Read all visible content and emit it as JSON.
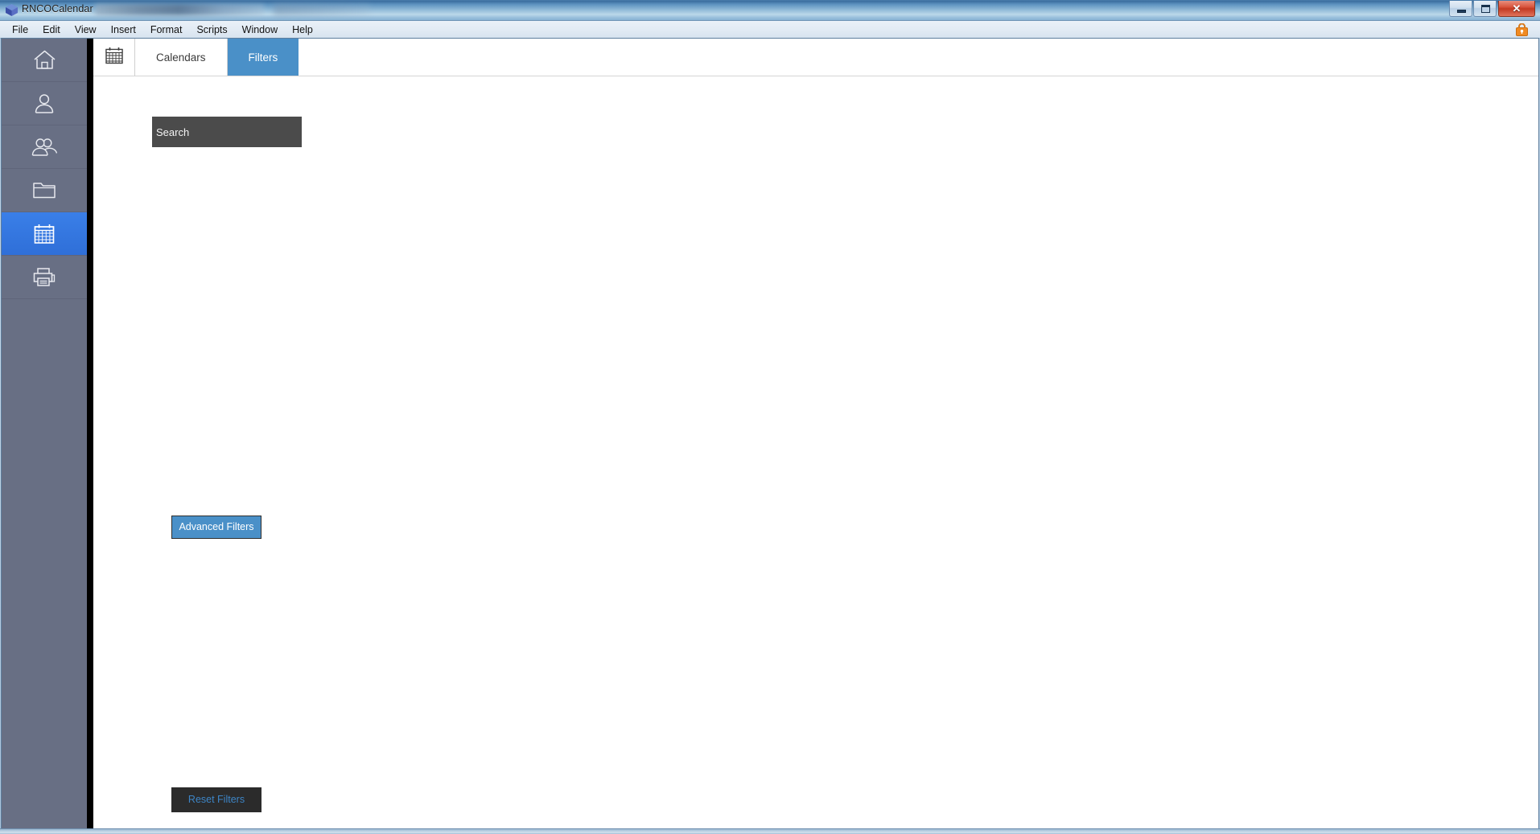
{
  "window": {
    "title": "RNCOCalendar",
    "app_icon": "cube-icon",
    "controls": {
      "minimize_label": "–",
      "maximize_label": "□",
      "close_label": "✕"
    }
  },
  "menubar": {
    "items": [
      {
        "label": "File",
        "name": "menu-file"
      },
      {
        "label": "Edit",
        "name": "menu-edit"
      },
      {
        "label": "View",
        "name": "menu-view"
      },
      {
        "label": "Insert",
        "name": "menu-insert"
      },
      {
        "label": "Format",
        "name": "menu-format"
      },
      {
        "label": "Scripts",
        "name": "menu-scripts"
      },
      {
        "label": "Window",
        "name": "menu-window"
      },
      {
        "label": "Help",
        "name": "menu-help"
      }
    ],
    "lock_icon": "lock-icon"
  },
  "sidebar": {
    "items": [
      {
        "label": "Home",
        "icon": "home-icon",
        "active": false
      },
      {
        "label": "Contact",
        "icon": "person-icon",
        "active": false
      },
      {
        "label": "Contacts",
        "icon": "people-icon",
        "active": false
      },
      {
        "label": "Files",
        "icon": "folder-icon",
        "active": false
      },
      {
        "label": "Calendar",
        "icon": "calendar-icon",
        "active": true
      },
      {
        "label": "Print",
        "icon": "printer-icon",
        "active": false
      }
    ]
  },
  "tabs": {
    "icon": "calendar-icon",
    "items": [
      {
        "label": "Calendars",
        "active": false
      },
      {
        "label": "Filters",
        "active": true
      }
    ]
  },
  "main": {
    "search": {
      "value": "Search",
      "placeholder": "Search"
    },
    "advanced_filters_label": "Advanced Filters",
    "reset_filters_label": "Reset Filters"
  },
  "colors": {
    "accent_blue": "#4a90c8",
    "nav_active_blue": "#3376e0",
    "sidebar_bg": "#686f84",
    "search_bg": "#4b4b4b",
    "reset_bg": "#2b2b2b",
    "reset_text": "#3d85c6"
  }
}
